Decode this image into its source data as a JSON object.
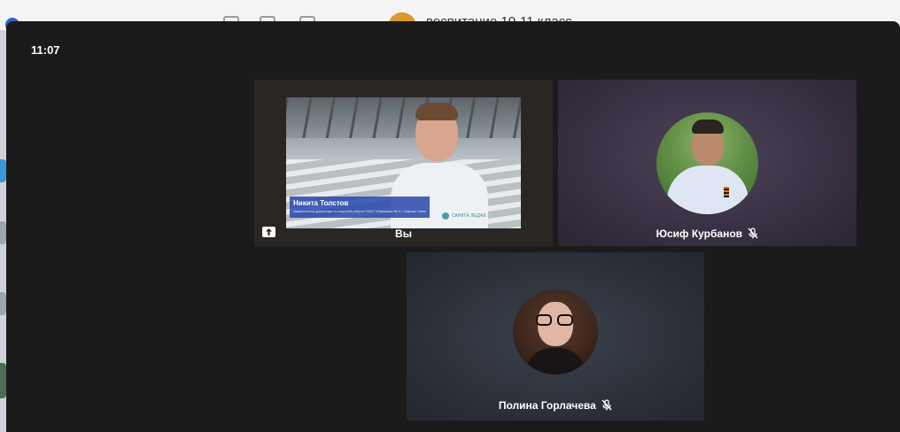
{
  "background_app": {
    "chat_title": "воспитание 10-11 класс"
  },
  "call": {
    "clock": "11:07",
    "tiles": [
      {
        "label": "Вы",
        "video_caption_name": "Никита Толстов",
        "video_caption_sub": "Заместитель директора по научной работе ГБОУ «Гимназия № 9 г. Кирово-Чепецк»",
        "shirt_text": "САНКТА ЛЕДЖЕ"
      },
      {
        "label": "Юсиф Курбанов",
        "muted": true
      },
      {
        "label": "Полина Горлачева",
        "muted": true
      }
    ]
  },
  "colors": {
    "overlay_bg": "#1b1b1c",
    "label_text": "#ffffff",
    "caption_bar": "#2846aa"
  },
  "icons": {
    "share_screen": "share-screen-icon",
    "mic_muted": "mic-off-icon"
  }
}
